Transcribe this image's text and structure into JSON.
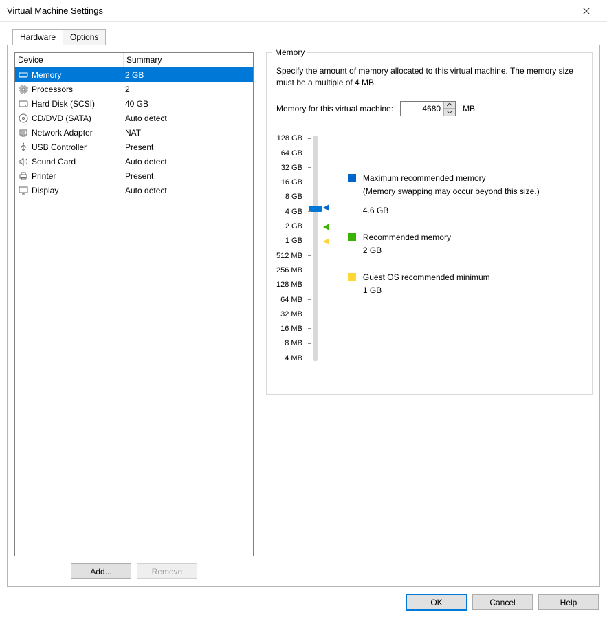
{
  "window": {
    "title": "Virtual Machine Settings"
  },
  "tabs": {
    "hardware": "Hardware",
    "options": "Options"
  },
  "columns": {
    "device": "Device",
    "summary": "Summary"
  },
  "devices": [
    {
      "id": "memory",
      "name": "Memory",
      "summary": "2 GB",
      "icon": "memory-icon",
      "selected": true
    },
    {
      "id": "processors",
      "name": "Processors",
      "summary": "2",
      "icon": "cpu-icon"
    },
    {
      "id": "harddisk",
      "name": "Hard Disk (SCSI)",
      "summary": "40 GB",
      "icon": "disk-icon"
    },
    {
      "id": "cddvd",
      "name": "CD/DVD (SATA)",
      "summary": "Auto detect",
      "icon": "cd-icon"
    },
    {
      "id": "network",
      "name": "Network Adapter",
      "summary": "NAT",
      "icon": "network-icon"
    },
    {
      "id": "usb",
      "name": "USB Controller",
      "summary": "Present",
      "icon": "usb-icon"
    },
    {
      "id": "sound",
      "name": "Sound Card",
      "summary": "Auto detect",
      "icon": "sound-icon"
    },
    {
      "id": "printer",
      "name": "Printer",
      "summary": "Present",
      "icon": "printer-icon"
    },
    {
      "id": "display",
      "name": "Display",
      "summary": "Auto detect",
      "icon": "display-icon"
    }
  ],
  "device_buttons": {
    "add": "Add...",
    "remove": "Remove"
  },
  "memory_panel": {
    "group_title": "Memory",
    "description": "Specify the amount of memory allocated to this virtual machine. The memory size must be a multiple of 4 MB.",
    "input_label": "Memory for this virtual machine:",
    "input_value": "4680",
    "input_unit": "MB",
    "scale": [
      "128 GB",
      "64 GB",
      "32 GB",
      "16 GB",
      "8 GB",
      "4 GB",
      "2 GB",
      "1 GB",
      "512 MB",
      "256 MB",
      "128 MB",
      "64 MB",
      "32 MB",
      "16 MB",
      "8 MB",
      "4 MB"
    ],
    "legend": {
      "max_label": "Maximum recommended memory",
      "max_sub": "(Memory swapping may occur beyond this size.)",
      "max_value": "4.6 GB",
      "rec_label": "Recommended memory",
      "rec_value": "2 GB",
      "min_label": "Guest OS recommended minimum",
      "min_value": "1 GB"
    }
  },
  "dialog_buttons": {
    "ok": "OK",
    "cancel": "Cancel",
    "help": "Help"
  },
  "colors": {
    "selection": "#0078d7",
    "blue_marker": "#0066cc",
    "green_marker": "#39b200",
    "yellow_marker": "#ffd633"
  }
}
